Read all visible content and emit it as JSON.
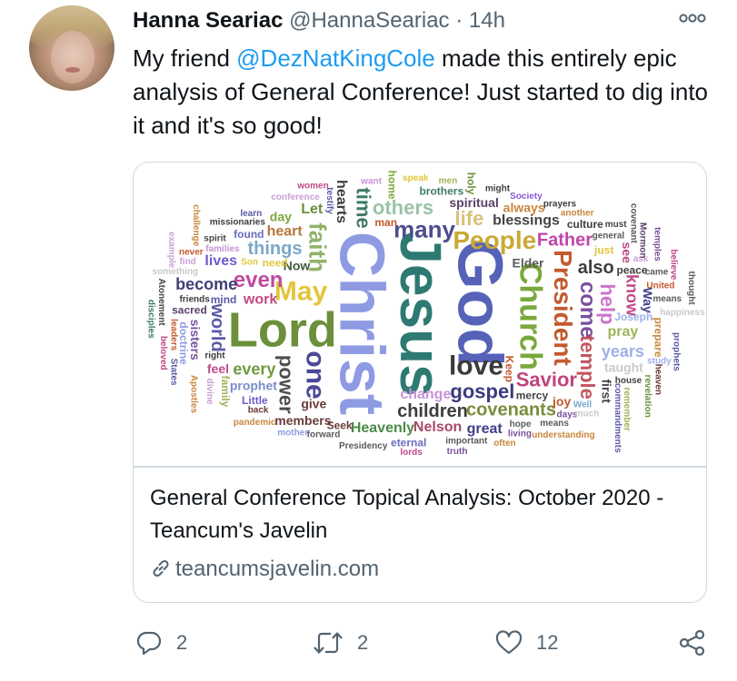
{
  "author": {
    "name": "Hanna Seariac",
    "handle": "@HannaSeariac",
    "separator": "·",
    "time": "14h"
  },
  "tweet": {
    "text_before": "My friend ",
    "mention": "@DezNatKingCole",
    "text_after": " made this entirely epic analysis of General Conference! Just started to dig into it and it's so good!"
  },
  "card": {
    "title": "General Conference Topical Analysis: October 2020 - Teancum's Javelin",
    "domain": "teancumsjavelin.com",
    "word_cloud": [
      {
        "w": "Jesus",
        "c": "#2d7a73",
        "s": 64,
        "r": 90
      },
      {
        "w": "Christ",
        "c": "#8e9be3",
        "s": 70,
        "r": 90
      },
      {
        "w": "God",
        "c": "#5562b8",
        "s": 70,
        "r": 90
      },
      {
        "w": "Lord",
        "c": "#6b8f3a",
        "s": 54,
        "r": 0
      },
      {
        "w": "Church",
        "c": "#7aa83c",
        "s": 34,
        "r": 90
      },
      {
        "w": "love",
        "c": "#3a3a3a",
        "s": 30,
        "r": 0
      },
      {
        "w": "May",
        "c": "#e3c53d",
        "s": 30,
        "r": 0
      },
      {
        "w": "People",
        "c": "#c9a938",
        "s": 28,
        "r": 0
      },
      {
        "w": "President",
        "c": "#c35a2e",
        "s": 28,
        "r": 90
      },
      {
        "w": "one",
        "c": "#4a4a95",
        "s": 30,
        "r": 90
      },
      {
        "w": "many",
        "c": "#4d4d8c",
        "s": 26,
        "r": 0
      },
      {
        "w": "faith",
        "c": "#8fb36a",
        "s": 26,
        "r": 90
      },
      {
        "w": "gospel",
        "c": "#3b3b80",
        "s": 22,
        "r": 0
      },
      {
        "w": "children",
        "c": "#3d3d3d",
        "s": 20,
        "r": 0
      },
      {
        "w": "Savior",
        "c": "#c0447b",
        "s": 22,
        "r": 0
      },
      {
        "w": "even",
        "c": "#c04aa0",
        "s": 24,
        "r": 0
      },
      {
        "w": "come",
        "c": "#7a4f9e",
        "s": 24,
        "r": 90
      },
      {
        "w": "power",
        "c": "#4d4d4d",
        "s": 22,
        "r": 90
      },
      {
        "w": "help",
        "c": "#cc76c9",
        "s": 22,
        "r": 90
      },
      {
        "w": "time",
        "c": "#3f7a66",
        "s": 22,
        "r": 90
      },
      {
        "w": "temple",
        "c": "#c25560",
        "s": 22,
        "r": 90
      },
      {
        "w": "life",
        "c": "#d8c27a",
        "s": 22,
        "r": 0
      },
      {
        "w": "others",
        "c": "#9bc3a6",
        "s": 22,
        "r": 0
      },
      {
        "w": "covenants",
        "c": "#7a8d3a",
        "s": 20,
        "r": 0
      },
      {
        "w": "things",
        "c": "#7ba8c9",
        "s": 20,
        "r": 0
      },
      {
        "w": "Father",
        "c": "#c046a8",
        "s": 20,
        "r": 0
      },
      {
        "w": "also",
        "c": "#3d3d3d",
        "s": 20,
        "r": 0
      },
      {
        "w": "world",
        "c": "#5a5aa8",
        "s": 20,
        "r": 90
      },
      {
        "w": "every",
        "c": "#6f9a3f",
        "s": 18,
        "r": 0
      },
      {
        "w": "heart",
        "c": "#b6773b",
        "s": 16,
        "r": 0
      },
      {
        "w": "Nelson",
        "c": "#a84a6a",
        "s": 16,
        "r": 0
      },
      {
        "w": "blessings",
        "c": "#444444",
        "s": 16,
        "r": 0
      },
      {
        "w": "Heavenly",
        "c": "#4b8a45",
        "s": 16,
        "r": 0
      },
      {
        "w": "years",
        "c": "#9fb0e8",
        "s": 18,
        "r": 0
      },
      {
        "w": "change",
        "c": "#c992d6",
        "s": 16,
        "r": 0
      },
      {
        "w": "become",
        "c": "#3f3f7a",
        "s": 18,
        "r": 0
      },
      {
        "w": "know",
        "c": "#c04a85",
        "s": 18,
        "r": 90
      },
      {
        "w": "hearts",
        "c": "#3d3d3d",
        "s": 16,
        "r": 90
      },
      {
        "w": "spiritual",
        "c": "#5a3f6a",
        "s": 14,
        "r": 0
      },
      {
        "w": "prophet",
        "c": "#7a8cc9",
        "s": 14,
        "r": 0
      },
      {
        "w": "members",
        "c": "#6b3a3a",
        "s": 14,
        "r": 0
      },
      {
        "w": "always",
        "c": "#c9873d",
        "s": 14,
        "r": 0
      },
      {
        "w": "work",
        "c": "#c04a85",
        "s": 16,
        "r": 0
      },
      {
        "w": "great",
        "c": "#3f3f8a",
        "s": 16,
        "r": 0
      },
      {
        "w": "pray",
        "c": "#9fb35a",
        "s": 16,
        "r": 0
      },
      {
        "w": "Elder",
        "c": "#5a5a5a",
        "s": 14,
        "r": 0
      },
      {
        "w": "lives",
        "c": "#6f5acb",
        "s": 16,
        "r": 0
      },
      {
        "w": "Now",
        "c": "#3f5a3a",
        "s": 14,
        "r": 0
      },
      {
        "w": "Let",
        "c": "#6b8f3a",
        "s": 16,
        "r": 0
      },
      {
        "w": "need",
        "c": "#e3c53d",
        "s": 12,
        "r": 0
      },
      {
        "w": "brothers",
        "c": "#3f7a66",
        "s": 12,
        "r": 0
      },
      {
        "w": "Seek",
        "c": "#6b3a3a",
        "s": 12,
        "r": 0
      },
      {
        "w": "mind",
        "c": "#5a5aa8",
        "s": 12,
        "r": 0
      },
      {
        "w": "sisters",
        "c": "#7a4f9e",
        "s": 14,
        "r": 90
      },
      {
        "w": "taught",
        "c": "#c9c9c9",
        "s": 14,
        "r": 0
      },
      {
        "w": "Joseph",
        "c": "#9fb0e8",
        "s": 12,
        "r": 0
      },
      {
        "w": "found",
        "c": "#6a6ac0",
        "s": 12,
        "r": 0
      },
      {
        "w": "mercy",
        "c": "#444444",
        "s": 12,
        "r": 0
      },
      {
        "w": "culture",
        "c": "#3d3d3d",
        "s": 12,
        "r": 0
      },
      {
        "w": "eternal",
        "c": "#6a6ac0",
        "s": 12,
        "r": 0
      },
      {
        "w": "joy",
        "c": "#c35a2e",
        "s": 14,
        "r": 0
      },
      {
        "w": "give",
        "c": "#6b3a3a",
        "s": 14,
        "r": 0
      },
      {
        "w": "man",
        "c": "#c35a2e",
        "s": 12,
        "r": 0
      },
      {
        "w": "home",
        "c": "#7aa83c",
        "s": 12,
        "r": 90
      },
      {
        "w": "peace",
        "c": "#3d3d3d",
        "s": 12,
        "r": 0
      },
      {
        "w": "Little",
        "c": "#6f5acb",
        "s": 12,
        "r": 0
      },
      {
        "w": "feel",
        "c": "#c04a85",
        "s": 14,
        "r": 0
      },
      {
        "w": "day",
        "c": "#7aa83c",
        "s": 14,
        "r": 0
      },
      {
        "w": "just",
        "c": "#e3c53d",
        "s": 12,
        "r": 0
      },
      {
        "w": "friends",
        "c": "#3d3d3d",
        "s": 10,
        "r": 0
      },
      {
        "w": "hope",
        "c": "#5a5a5a",
        "s": 10,
        "r": 0
      },
      {
        "w": "sacred",
        "c": "#5a3f6a",
        "s": 12,
        "r": 0
      },
      {
        "w": "Keep",
        "c": "#c35a2e",
        "s": 12,
        "r": 90
      },
      {
        "w": "first",
        "c": "#444444",
        "s": 14,
        "r": 90
      },
      {
        "w": "Way",
        "c": "#3f3f8a",
        "s": 14,
        "r": 90
      },
      {
        "w": "see",
        "c": "#c04a85",
        "s": 14,
        "r": 90
      },
      {
        "w": "prepare",
        "c": "#c9873d",
        "s": 12,
        "r": 90
      },
      {
        "w": "doctrine",
        "c": "#8e9be3",
        "s": 12,
        "r": 90
      },
      {
        "w": "family",
        "c": "#9fb35a",
        "s": 12,
        "r": 90
      },
      {
        "w": "holy",
        "c": "#6b8f3a",
        "s": 12,
        "r": 90
      },
      {
        "w": "important",
        "c": "#5a5a5a",
        "s": 10,
        "r": 0
      },
      {
        "w": "Society",
        "c": "#8e5ad6",
        "s": 10,
        "r": 0
      },
      {
        "w": "forward",
        "c": "#5a5a5a",
        "s": 10,
        "r": 0
      },
      {
        "w": "families",
        "c": "#c992d6",
        "s": 10,
        "r": 0
      },
      {
        "w": "might",
        "c": "#3d3d3d",
        "s": 10,
        "r": 0
      },
      {
        "w": "Well",
        "c": "#7ba8c9",
        "s": 10,
        "r": 0
      },
      {
        "w": "general",
        "c": "#5a5a5a",
        "s": 10,
        "r": 0
      },
      {
        "w": "missionaries",
        "c": "#3d3d3d",
        "s": 10,
        "r": 0
      },
      {
        "w": "conference",
        "c": "#c9a0d6",
        "s": 10,
        "r": 0
      },
      {
        "w": "means",
        "c": "#5a5a5a",
        "s": 10,
        "r": 0
      },
      {
        "w": "back",
        "c": "#6b3a3a",
        "s": 10,
        "r": 0
      },
      {
        "w": "another",
        "c": "#c9873d",
        "s": 10,
        "r": 0
      },
      {
        "w": "speak",
        "c": "#e3c53d",
        "s": 10,
        "r": 0
      },
      {
        "w": "living",
        "c": "#7a4f9e",
        "s": 10,
        "r": 0
      },
      {
        "w": "Presidency",
        "c": "#5a5a5a",
        "s": 10,
        "r": 0
      },
      {
        "w": "truth",
        "c": "#7a4f9e",
        "s": 10,
        "r": 0
      },
      {
        "w": "want",
        "c": "#c992d6",
        "s": 10,
        "r": 0
      },
      {
        "w": "something",
        "c": "#c9c9c9",
        "s": 10,
        "r": 0
      },
      {
        "w": "spirit",
        "c": "#444444",
        "s": 10,
        "r": 0
      },
      {
        "w": "house",
        "c": "#444444",
        "s": 10,
        "r": 0
      },
      {
        "w": "United",
        "c": "#c35a2e",
        "s": 10,
        "r": 0
      },
      {
        "w": "prayers",
        "c": "#3d3d3d",
        "s": 10,
        "r": 0
      },
      {
        "w": "right",
        "c": "#3d3d3d",
        "s": 10,
        "r": 0
      },
      {
        "w": "mother",
        "c": "#8e9be3",
        "s": 10,
        "r": 0
      },
      {
        "w": "happiness",
        "c": "#c9c9c9",
        "s": 10,
        "r": 0
      },
      {
        "w": "understanding",
        "c": "#c9873d",
        "s": 10,
        "r": 0
      },
      {
        "w": "days",
        "c": "#7a4f9e",
        "s": 10,
        "r": 0
      },
      {
        "w": "often",
        "c": "#c9873d",
        "s": 10,
        "r": 0
      },
      {
        "w": "much",
        "c": "#c9c9c9",
        "s": 10,
        "r": 0
      },
      {
        "w": "never",
        "c": "#c35a2e",
        "s": 10,
        "r": 0
      },
      {
        "w": "came",
        "c": "#5a5a5a",
        "s": 10,
        "r": 0
      },
      {
        "w": "must",
        "c": "#444444",
        "s": 10,
        "r": 0
      },
      {
        "w": "men",
        "c": "#9fb35a",
        "s": 10,
        "r": 0
      },
      {
        "w": "Son",
        "c": "#e3c53d",
        "s": 10,
        "r": 0
      },
      {
        "w": "lords",
        "c": "#c04a85",
        "s": 10,
        "r": 0
      },
      {
        "w": "pandemic",
        "c": "#c9873d",
        "s": 10,
        "r": 0
      },
      {
        "w": "learn",
        "c": "#5a5aa8",
        "s": 10,
        "r": 0
      },
      {
        "w": "women",
        "c": "#c04a85",
        "s": 10,
        "r": 0
      },
      {
        "w": "find",
        "c": "#c9a0d6",
        "s": 10,
        "r": 0
      },
      {
        "w": "study",
        "c": "#9fb0e8",
        "s": 10,
        "r": 0
      },
      {
        "w": "ask",
        "c": "#c9a0d6",
        "s": 10,
        "r": 0
      },
      {
        "w": "means",
        "c": "#5a5a5a",
        "s": 10,
        "r": 0
      },
      {
        "w": "leaders",
        "c": "#c35a2e",
        "s": 10,
        "r": 90
      },
      {
        "w": "testify",
        "c": "#5a5aa8",
        "s": 10,
        "r": 90
      },
      {
        "w": "divine",
        "c": "#c9a0d6",
        "s": 10,
        "r": 90
      },
      {
        "w": "Atonement",
        "c": "#444444",
        "s": 10,
        "r": 90
      },
      {
        "w": "commandments",
        "c": "#5a5aa8",
        "s": 10,
        "r": 90
      },
      {
        "w": "believe",
        "c": "#c04a85",
        "s": 10,
        "r": 90
      },
      {
        "w": "disciples",
        "c": "#3f7a66",
        "s": 10,
        "r": 90
      },
      {
        "w": "prophets",
        "c": "#5a5aa8",
        "s": 10,
        "r": 90
      },
      {
        "w": "revelation",
        "c": "#6b8f3a",
        "s": 10,
        "r": 90
      },
      {
        "w": "Mormon",
        "c": "#5a3f6a",
        "s": 10,
        "r": 90
      },
      {
        "w": "Apostles",
        "c": "#c9873d",
        "s": 10,
        "r": 90
      },
      {
        "w": "beloved",
        "c": "#c04a85",
        "s": 10,
        "r": 90
      },
      {
        "w": "covenant",
        "c": "#5a5a5a",
        "s": 10,
        "r": 90
      },
      {
        "w": "remember",
        "c": "#9fb35a",
        "s": 10,
        "r": 90
      },
      {
        "w": "States",
        "c": "#5a5aa8",
        "s": 10,
        "r": 90
      },
      {
        "w": "challenge",
        "c": "#c9873d",
        "s": 10,
        "r": 90
      },
      {
        "w": "temples",
        "c": "#7a4f9e",
        "s": 10,
        "r": 90
      },
      {
        "w": "thought",
        "c": "#5a5a5a",
        "s": 10,
        "r": 90
      },
      {
        "w": "heaven",
        "c": "#6b3a3a",
        "s": 10,
        "r": 90
      },
      {
        "w": "example",
        "c": "#c9a0d6",
        "s": 10,
        "r": 90
      }
    ]
  },
  "actions": {
    "replies": "2",
    "retweets": "2",
    "likes": "12"
  },
  "icons": {
    "more": "more-icon",
    "link": "link-icon",
    "reply": "reply-icon",
    "retweet": "retweet-icon",
    "like": "like-icon",
    "share": "share-icon"
  },
  "colors": {
    "text": "#0f1419",
    "muted": "#536471",
    "link": "#1d9bf0",
    "border": "#cfd9de"
  }
}
